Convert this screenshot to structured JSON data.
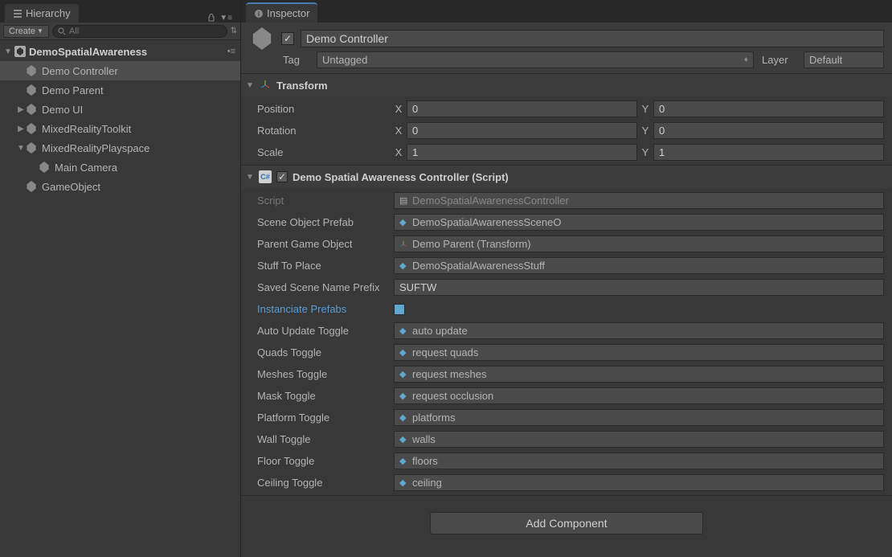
{
  "hierarchy": {
    "tab_label": "Hierarchy",
    "create_label": "Create",
    "search_placeholder": "All",
    "scene": "DemoSpatialAwareness",
    "items": [
      {
        "label": "Demo Controller",
        "indent": 1,
        "selected": true
      },
      {
        "label": "Demo Parent",
        "indent": 1
      },
      {
        "label": "Demo UI",
        "indent": 1,
        "expandable": true
      },
      {
        "label": "MixedRealityToolkit",
        "indent": 1,
        "expandable": true
      },
      {
        "label": "MixedRealityPlayspace",
        "indent": 1,
        "expanded": true
      },
      {
        "label": "Main Camera",
        "indent": 2
      },
      {
        "label": "GameObject",
        "indent": 1
      }
    ]
  },
  "inspector": {
    "tab_label": "Inspector",
    "object_name": "Demo Controller",
    "tag_label": "Tag",
    "tag_value": "Untagged",
    "layer_label": "Layer",
    "layer_value": "Default",
    "transform": {
      "title": "Transform",
      "position_label": "Position",
      "rotation_label": "Rotation",
      "scale_label": "Scale",
      "pos": {
        "x": "0",
        "y": "0"
      },
      "rot": {
        "x": "0",
        "y": "0"
      },
      "scl": {
        "x": "1",
        "y": "1"
      }
    },
    "script": {
      "title": "Demo Spatial Awareness Controller (Script)",
      "props": {
        "script_label": "Script",
        "script_value": "DemoSpatialAwarenessController",
        "scene_prefab_label": "Scene Object Prefab",
        "scene_prefab_value": "DemoSpatialAwarenessSceneO",
        "parent_label": "Parent Game Object",
        "parent_value": "Demo Parent (Transform)",
        "stuff_label": "Stuff To Place",
        "stuff_value": "DemoSpatialAwarenessStuff",
        "saved_prefix_label": "Saved Scene Name Prefix",
        "saved_prefix_value": "SUFTW",
        "instanciate_label": "Instanciate Prefabs",
        "auto_update_label": "Auto Update Toggle",
        "auto_update_value": "auto update",
        "quads_label": "Quads Toggle",
        "quads_value": "request quads",
        "meshes_label": "Meshes Toggle",
        "meshes_value": "request meshes",
        "mask_label": "Mask Toggle",
        "mask_value": "request occlusion",
        "platform_label": "Platform Toggle",
        "platform_value": "platforms",
        "wall_label": "Wall Toggle",
        "wall_value": "walls",
        "floor_label": "Floor Toggle",
        "floor_value": "floors",
        "ceiling_label": "Ceiling Toggle",
        "ceiling_value": "ceiling"
      }
    },
    "add_component_label": "Add Component"
  }
}
